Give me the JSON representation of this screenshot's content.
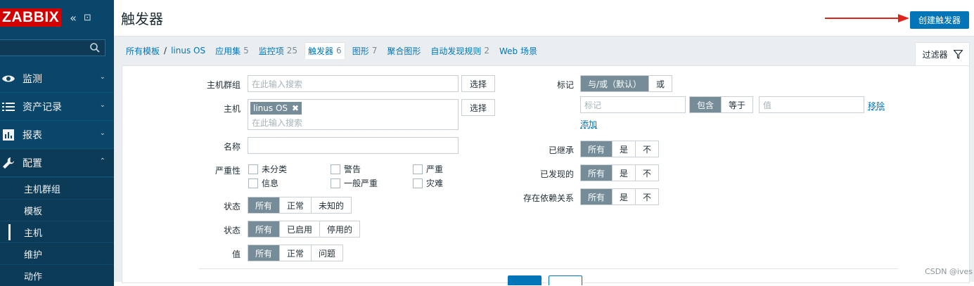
{
  "sidebar": {
    "logo": "ZABBIX",
    "collapse_glyph": "«",
    "kiosk_glyph": "⊡",
    "search_placeholder": "",
    "menu": [
      {
        "label": "监测",
        "icon": "eye-icon",
        "chevron": "⌄"
      },
      {
        "label": "资产记录",
        "icon": "list-icon",
        "chevron": "⌄"
      },
      {
        "label": "报表",
        "icon": "bar-chart-icon",
        "chevron": "⌄"
      },
      {
        "label": "配置",
        "icon": "wrench-icon",
        "chevron": "⌃"
      }
    ],
    "submenu": [
      "主机群组",
      "模板",
      "主机",
      "维护",
      "动作"
    ]
  },
  "header": {
    "title": "触发器",
    "create_button": "创建触发器"
  },
  "breadcrumb": {
    "all_templates": "所有模板",
    "separator": "/",
    "host": "linus OS",
    "tabs": [
      {
        "label": "应用集",
        "count": "5"
      },
      {
        "label": "监控项",
        "count": "25"
      },
      {
        "label": "触发器",
        "count": "6"
      },
      {
        "label": "图形",
        "count": "7"
      },
      {
        "label": "聚合图形",
        "count": ""
      },
      {
        "label": "自动发现规则",
        "count": "2"
      },
      {
        "label": "Web 场景",
        "count": ""
      }
    ],
    "filter_tab": "过滤器"
  },
  "filter": {
    "host_group": {
      "label": "主机群组",
      "placeholder": "在此输入搜索",
      "select": "选择"
    },
    "host": {
      "label": "主机",
      "chip": "linus OS",
      "chip_remove": "✖",
      "placeholder": "在此输入搜索",
      "select": "选择"
    },
    "name": {
      "label": "名称",
      "value": ""
    },
    "severity": {
      "label": "严重性",
      "options": [
        "未分类",
        "警告",
        "严重",
        "信息",
        "一般严重",
        "灾难"
      ]
    },
    "state": {
      "label": "状态",
      "options": [
        "所有",
        "正常",
        "未知的"
      ]
    },
    "status": {
      "label": "状态",
      "options": [
        "所有",
        "已启用",
        "停用的"
      ]
    },
    "value": {
      "label": "值",
      "options": [
        "所有",
        "正常",
        "问题"
      ]
    },
    "tags": {
      "label": "标记",
      "mode_options": [
        "与/或（默认）",
        "或"
      ],
      "tag_placeholder": "标记",
      "operator_options": [
        "包含",
        "等于"
      ],
      "value_placeholder": "值",
      "remove": "移除",
      "add": "添加"
    },
    "inherited": {
      "label": "已继承",
      "options": [
        "所有",
        "是",
        "不"
      ]
    },
    "discovered": {
      "label": "已发现的",
      "options": [
        "所有",
        "是",
        "不"
      ]
    },
    "dependencies": {
      "label": "存在依赖关系",
      "options": [
        "所有",
        "是",
        "不"
      ]
    }
  },
  "watermark": "CSDN @ives"
}
